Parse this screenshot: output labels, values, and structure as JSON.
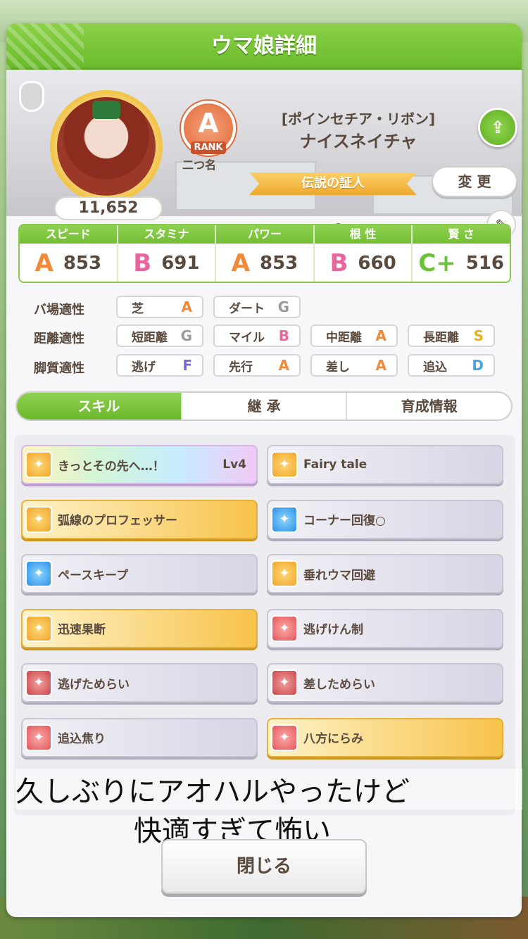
{
  "header": {
    "title": "ウマ娘詳細"
  },
  "profile": {
    "fans": "11,652",
    "rank_tag": "RANK",
    "rank_letter": "A",
    "nickname_label": "二つ名",
    "outfit": "[ポインセチア・リボン]",
    "name": "ナイスネイチャ",
    "title": "伝説の証人",
    "change_label": "変 更",
    "dash": "-"
  },
  "stats": [
    {
      "label": "スピード",
      "icon": "shoe-icon",
      "grade": "A",
      "value": "853",
      "color": "#ef8a3a"
    },
    {
      "label": "スタミナ",
      "icon": "heart-icon",
      "grade": "B",
      "value": "691",
      "color": "#e8659e"
    },
    {
      "label": "パワー",
      "icon": "arm-icon",
      "grade": "A",
      "value": "853",
      "color": "#ef8a3a"
    },
    {
      "label": "根 性",
      "icon": "flame-icon",
      "grade": "B",
      "value": "660",
      "color": "#e8659e"
    },
    {
      "label": "賢 さ",
      "icon": "cap-icon",
      "grade": "C+",
      "value": "516",
      "color": "#6cc23a"
    }
  ],
  "aptitude": {
    "rows": [
      {
        "label": "バ場適性",
        "items": [
          {
            "name": "芝",
            "grade": "A",
            "color": "#ef8a3a"
          },
          {
            "name": "ダート",
            "grade": "G",
            "color": "#9a9a9a"
          }
        ]
      },
      {
        "label": "距離適性",
        "items": [
          {
            "name": "短距離",
            "grade": "G",
            "color": "#9a9a9a"
          },
          {
            "name": "マイル",
            "grade": "B",
            "color": "#e8659e"
          },
          {
            "name": "中距離",
            "grade": "A",
            "color": "#ef8a3a"
          },
          {
            "name": "長距離",
            "grade": "S",
            "color": "#e2b21f"
          }
        ]
      },
      {
        "label": "脚質適性",
        "items": [
          {
            "name": "逃げ",
            "grade": "F",
            "color": "#7a6ad8"
          },
          {
            "name": "先行",
            "grade": "A",
            "color": "#ef8a3a"
          },
          {
            "name": "差し",
            "grade": "A",
            "color": "#ef8a3a"
          },
          {
            "name": "追込",
            "grade": "D",
            "color": "#4aa6e0"
          }
        ]
      }
    ]
  },
  "tabs": [
    {
      "label": "スキル",
      "active": true
    },
    {
      "label": "継 承",
      "active": false
    },
    {
      "label": "育成情報",
      "active": false
    }
  ],
  "skills": [
    {
      "name": "きっとその先へ…！",
      "level": "Lv4",
      "style": "rainbow",
      "icon": "si-gold"
    },
    {
      "name": "Fairy tale",
      "level": "",
      "style": "plain",
      "icon": "si-gold"
    },
    {
      "name": "弧線のプロフェッサー",
      "level": "",
      "style": "gold",
      "icon": "si-gold"
    },
    {
      "name": "コーナー回復○",
      "level": "",
      "style": "plain",
      "icon": "si-blue"
    },
    {
      "name": "ペースキープ",
      "level": "",
      "style": "plain",
      "icon": "si-blue"
    },
    {
      "name": "垂れウマ回避",
      "level": "",
      "style": "plain",
      "icon": "si-gold"
    },
    {
      "name": "迅速果断",
      "level": "",
      "style": "gold",
      "icon": "si-gold"
    },
    {
      "name": "逃げけん制",
      "level": "",
      "style": "plain",
      "icon": "si-red"
    },
    {
      "name": "逃げためらい",
      "level": "",
      "style": "plain",
      "icon": "si-dred"
    },
    {
      "name": "差しためらい",
      "level": "",
      "style": "plain",
      "icon": "si-dred"
    },
    {
      "name": "追込焦り",
      "level": "",
      "style": "plain",
      "icon": "si-red"
    },
    {
      "name": "八方にらみ",
      "level": "",
      "style": "gold",
      "icon": "si-red"
    }
  ],
  "caption": {
    "line1": "久しぶりにアオハルやったけど",
    "line2": "快適すぎて怖い"
  },
  "close_label": "閉じる"
}
